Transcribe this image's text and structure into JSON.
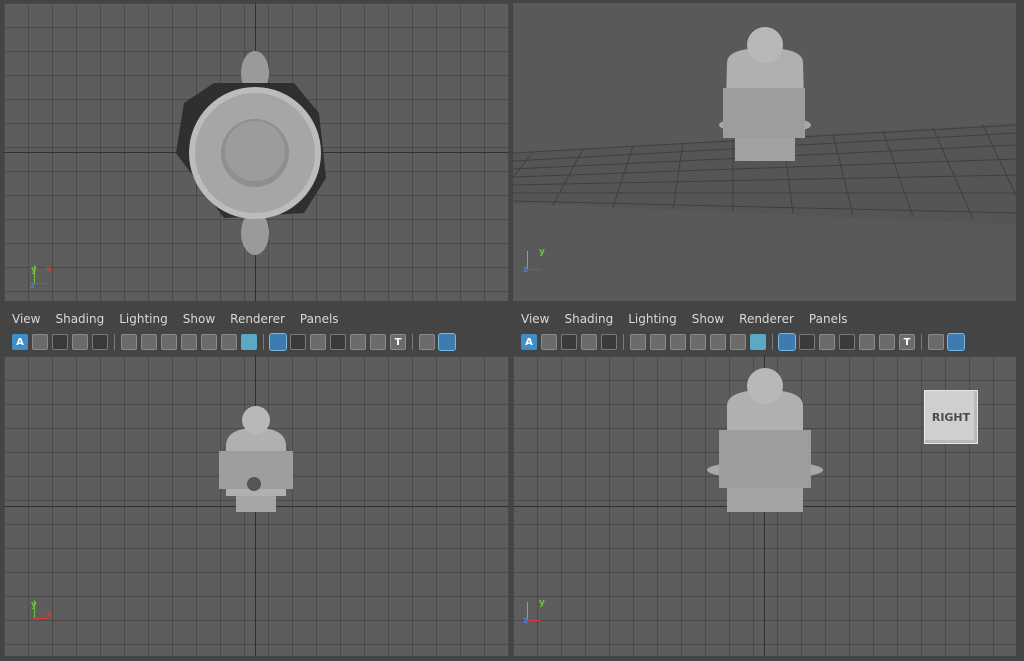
{
  "menu": [
    "View",
    "Shading",
    "Lighting",
    "Show",
    "Renderer",
    "Panels"
  ],
  "toolbar_icons": [
    "select-camera-icon",
    "camera-attributes-icon",
    "bookmarks-icon",
    "image-plane-icon",
    "2d-pan-zoom-icon",
    "grease-pencil-icon",
    "camera-icon",
    "lock-camera-icon",
    "attributes-icon",
    "gate-mask-icon",
    "grid-icon",
    "film-gate-icon",
    "resolution-gate-icon",
    "gate-mask-toggle-icon",
    "field-chart-icon",
    "safe-action-icon",
    "safe-title-icon",
    "wireframe-icon",
    "smooth-shade-icon"
  ],
  "viewcube": {
    "label": "RIGHT"
  },
  "axes": {
    "x": "x",
    "y": "y",
    "z": "z"
  },
  "colors": {
    "accent": "#3f8ec9",
    "viewport": "#5d5d5d",
    "panel": "#444444"
  }
}
